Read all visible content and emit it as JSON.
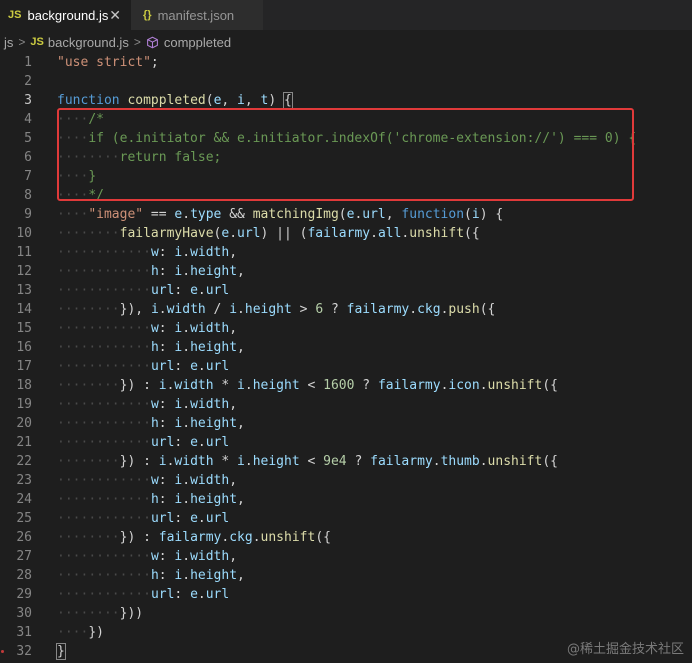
{
  "tabs": [
    {
      "badge": "JS",
      "label": "background.js",
      "close": "✕",
      "active": true
    },
    {
      "badge": "{}",
      "label": "manifest.json",
      "active": false
    }
  ],
  "breadcrumb": {
    "items": [
      "js",
      "background.js",
      "comppleted"
    ],
    "js_badge": "JS"
  },
  "watermark": "@稀土掘金技术社区",
  "lines": [
    {
      "n": "1",
      "i": 0,
      "tokens": [
        [
          "t-str",
          "\"use strict\""
        ],
        [
          "t-pn",
          ";"
        ]
      ]
    },
    {
      "n": "2",
      "i": 0,
      "tokens": []
    },
    {
      "n": "3",
      "i": 0,
      "tokens": [
        [
          "t-kw",
          "function"
        ],
        [
          "t-pn",
          " "
        ],
        [
          "t-fn",
          "comppleted"
        ],
        [
          "t-pn",
          "("
        ],
        [
          "t-var",
          "e"
        ],
        [
          "t-pn",
          ", "
        ],
        [
          "t-var",
          "i"
        ],
        [
          "t-pn",
          ", "
        ],
        [
          "t-var",
          "t"
        ],
        [
          "t-pn",
          ") "
        ],
        [
          "t-pn bracket-box",
          "{"
        ]
      ]
    },
    {
      "n": "4",
      "i": 1,
      "tokens": [
        [
          "t-cm",
          "/*"
        ]
      ]
    },
    {
      "n": "5",
      "i": 1,
      "tokens": [
        [
          "t-cm",
          "if (e.initiator && e.initiator.indexOf('chrome-extension://') === 0) {"
        ]
      ]
    },
    {
      "n": "6",
      "i": 2,
      "tokens": [
        [
          "t-cm",
          "return false;"
        ]
      ]
    },
    {
      "n": "7",
      "i": 1,
      "tokens": [
        [
          "t-cm",
          "}"
        ]
      ]
    },
    {
      "n": "8",
      "i": 1,
      "tokens": [
        [
          "t-cm",
          "*/"
        ]
      ]
    },
    {
      "n": "9",
      "i": 1,
      "tokens": [
        [
          "t-str",
          "\"image\""
        ],
        [
          "t-op",
          " == "
        ],
        [
          "t-var",
          "e"
        ],
        [
          "t-pn",
          "."
        ],
        [
          "t-var",
          "type"
        ],
        [
          "t-op",
          " && "
        ],
        [
          "t-fn",
          "matchingImg"
        ],
        [
          "t-pn",
          "("
        ],
        [
          "t-var",
          "e"
        ],
        [
          "t-pn",
          "."
        ],
        [
          "t-var",
          "url"
        ],
        [
          "t-pn",
          ", "
        ],
        [
          "t-kw",
          "function"
        ],
        [
          "t-pn",
          "("
        ],
        [
          "t-var",
          "i"
        ],
        [
          "t-pn",
          ") {"
        ]
      ]
    },
    {
      "n": "10",
      "i": 2,
      "tokens": [
        [
          "t-fn",
          "failarmyHave"
        ],
        [
          "t-pn",
          "("
        ],
        [
          "t-var",
          "e"
        ],
        [
          "t-pn",
          "."
        ],
        [
          "t-var",
          "url"
        ],
        [
          "t-pn",
          ") || ("
        ],
        [
          "t-var",
          "failarmy"
        ],
        [
          "t-pn",
          "."
        ],
        [
          "t-var",
          "all"
        ],
        [
          "t-pn",
          "."
        ],
        [
          "t-fn",
          "unshift"
        ],
        [
          "t-pn",
          "({"
        ]
      ]
    },
    {
      "n": "11",
      "i": 3,
      "tokens": [
        [
          "t-var",
          "w"
        ],
        [
          "t-pn",
          ": "
        ],
        [
          "t-var",
          "i"
        ],
        [
          "t-pn",
          "."
        ],
        [
          "t-var",
          "width"
        ],
        [
          "t-pn",
          ","
        ]
      ]
    },
    {
      "n": "12",
      "i": 3,
      "tokens": [
        [
          "t-var",
          "h"
        ],
        [
          "t-pn",
          ": "
        ],
        [
          "t-var",
          "i"
        ],
        [
          "t-pn",
          "."
        ],
        [
          "t-var",
          "height"
        ],
        [
          "t-pn",
          ","
        ]
      ]
    },
    {
      "n": "13",
      "i": 3,
      "tokens": [
        [
          "t-var",
          "url"
        ],
        [
          "t-pn",
          ": "
        ],
        [
          "t-var",
          "e"
        ],
        [
          "t-pn",
          "."
        ],
        [
          "t-var",
          "url"
        ]
      ]
    },
    {
      "n": "14",
      "i": 2,
      "tokens": [
        [
          "t-pn",
          "}), "
        ],
        [
          "t-var",
          "i"
        ],
        [
          "t-pn",
          "."
        ],
        [
          "t-var",
          "width"
        ],
        [
          "t-op",
          " / "
        ],
        [
          "t-var",
          "i"
        ],
        [
          "t-pn",
          "."
        ],
        [
          "t-var",
          "height"
        ],
        [
          "t-op",
          " > "
        ],
        [
          "t-num",
          "6"
        ],
        [
          "t-op",
          " ? "
        ],
        [
          "t-var",
          "failarmy"
        ],
        [
          "t-pn",
          "."
        ],
        [
          "t-var",
          "ckg"
        ],
        [
          "t-pn",
          "."
        ],
        [
          "t-fn",
          "push"
        ],
        [
          "t-pn",
          "({"
        ]
      ]
    },
    {
      "n": "15",
      "i": 3,
      "tokens": [
        [
          "t-var",
          "w"
        ],
        [
          "t-pn",
          ": "
        ],
        [
          "t-var",
          "i"
        ],
        [
          "t-pn",
          "."
        ],
        [
          "t-var",
          "width"
        ],
        [
          "t-pn",
          ","
        ]
      ]
    },
    {
      "n": "16",
      "i": 3,
      "tokens": [
        [
          "t-var",
          "h"
        ],
        [
          "t-pn",
          ": "
        ],
        [
          "t-var",
          "i"
        ],
        [
          "t-pn",
          "."
        ],
        [
          "t-var",
          "height"
        ],
        [
          "t-pn",
          ","
        ]
      ]
    },
    {
      "n": "17",
      "i": 3,
      "tokens": [
        [
          "t-var",
          "url"
        ],
        [
          "t-pn",
          ": "
        ],
        [
          "t-var",
          "e"
        ],
        [
          "t-pn",
          "."
        ],
        [
          "t-var",
          "url"
        ]
      ]
    },
    {
      "n": "18",
      "i": 2,
      "tokens": [
        [
          "t-pn",
          "}) : "
        ],
        [
          "t-var",
          "i"
        ],
        [
          "t-pn",
          "."
        ],
        [
          "t-var",
          "width"
        ],
        [
          "t-op",
          " * "
        ],
        [
          "t-var",
          "i"
        ],
        [
          "t-pn",
          "."
        ],
        [
          "t-var",
          "height"
        ],
        [
          "t-op",
          " < "
        ],
        [
          "t-num",
          "1600"
        ],
        [
          "t-op",
          " ? "
        ],
        [
          "t-var",
          "failarmy"
        ],
        [
          "t-pn",
          "."
        ],
        [
          "t-var",
          "icon"
        ],
        [
          "t-pn",
          "."
        ],
        [
          "t-fn",
          "unshift"
        ],
        [
          "t-pn",
          "({"
        ]
      ]
    },
    {
      "n": "19",
      "i": 3,
      "tokens": [
        [
          "t-var",
          "w"
        ],
        [
          "t-pn",
          ": "
        ],
        [
          "t-var",
          "i"
        ],
        [
          "t-pn",
          "."
        ],
        [
          "t-var",
          "width"
        ],
        [
          "t-pn",
          ","
        ]
      ]
    },
    {
      "n": "20",
      "i": 3,
      "tokens": [
        [
          "t-var",
          "h"
        ],
        [
          "t-pn",
          ": "
        ],
        [
          "t-var",
          "i"
        ],
        [
          "t-pn",
          "."
        ],
        [
          "t-var",
          "height"
        ],
        [
          "t-pn",
          ","
        ]
      ]
    },
    {
      "n": "21",
      "i": 3,
      "tokens": [
        [
          "t-var",
          "url"
        ],
        [
          "t-pn",
          ": "
        ],
        [
          "t-var",
          "e"
        ],
        [
          "t-pn",
          "."
        ],
        [
          "t-var",
          "url"
        ]
      ]
    },
    {
      "n": "22",
      "i": 2,
      "tokens": [
        [
          "t-pn",
          "}) : "
        ],
        [
          "t-var",
          "i"
        ],
        [
          "t-pn",
          "."
        ],
        [
          "t-var",
          "width"
        ],
        [
          "t-op",
          " * "
        ],
        [
          "t-var",
          "i"
        ],
        [
          "t-pn",
          "."
        ],
        [
          "t-var",
          "height"
        ],
        [
          "t-op",
          " < "
        ],
        [
          "t-num",
          "9e4"
        ],
        [
          "t-op",
          " ? "
        ],
        [
          "t-var",
          "failarmy"
        ],
        [
          "t-pn",
          "."
        ],
        [
          "t-var",
          "thumb"
        ],
        [
          "t-pn",
          "."
        ],
        [
          "t-fn",
          "unshift"
        ],
        [
          "t-pn",
          "({"
        ]
      ]
    },
    {
      "n": "23",
      "i": 3,
      "tokens": [
        [
          "t-var",
          "w"
        ],
        [
          "t-pn",
          ": "
        ],
        [
          "t-var",
          "i"
        ],
        [
          "t-pn",
          "."
        ],
        [
          "t-var",
          "width"
        ],
        [
          "t-pn",
          ","
        ]
      ]
    },
    {
      "n": "24",
      "i": 3,
      "tokens": [
        [
          "t-var",
          "h"
        ],
        [
          "t-pn",
          ": "
        ],
        [
          "t-var",
          "i"
        ],
        [
          "t-pn",
          "."
        ],
        [
          "t-var",
          "height"
        ],
        [
          "t-pn",
          ","
        ]
      ]
    },
    {
      "n": "25",
      "i": 3,
      "tokens": [
        [
          "t-var",
          "url"
        ],
        [
          "t-pn",
          ": "
        ],
        [
          "t-var",
          "e"
        ],
        [
          "t-pn",
          "."
        ],
        [
          "t-var",
          "url"
        ]
      ]
    },
    {
      "n": "26",
      "i": 2,
      "tokens": [
        [
          "t-pn",
          "}) : "
        ],
        [
          "t-var",
          "failarmy"
        ],
        [
          "t-pn",
          "."
        ],
        [
          "t-var",
          "ckg"
        ],
        [
          "t-pn",
          "."
        ],
        [
          "t-fn",
          "unshift"
        ],
        [
          "t-pn",
          "({"
        ]
      ]
    },
    {
      "n": "27",
      "i": 3,
      "tokens": [
        [
          "t-var",
          "w"
        ],
        [
          "t-pn",
          ": "
        ],
        [
          "t-var",
          "i"
        ],
        [
          "t-pn",
          "."
        ],
        [
          "t-var",
          "width"
        ],
        [
          "t-pn",
          ","
        ]
      ]
    },
    {
      "n": "28",
      "i": 3,
      "tokens": [
        [
          "t-var",
          "h"
        ],
        [
          "t-pn",
          ": "
        ],
        [
          "t-var",
          "i"
        ],
        [
          "t-pn",
          "."
        ],
        [
          "t-var",
          "height"
        ],
        [
          "t-pn",
          ","
        ]
      ]
    },
    {
      "n": "29",
      "i": 3,
      "tokens": [
        [
          "t-var",
          "url"
        ],
        [
          "t-pn",
          ": "
        ],
        [
          "t-var",
          "e"
        ],
        [
          "t-pn",
          "."
        ],
        [
          "t-var",
          "url"
        ]
      ]
    },
    {
      "n": "30",
      "i": 2,
      "tokens": [
        [
          "t-pn",
          "}))"
        ]
      ]
    },
    {
      "n": "31",
      "i": 1,
      "tokens": [
        [
          "t-pn",
          "})"
        ]
      ]
    },
    {
      "n": "32",
      "i": 0,
      "tokens": [
        [
          "t-pn bracket-box",
          "}"
        ]
      ]
    }
  ]
}
